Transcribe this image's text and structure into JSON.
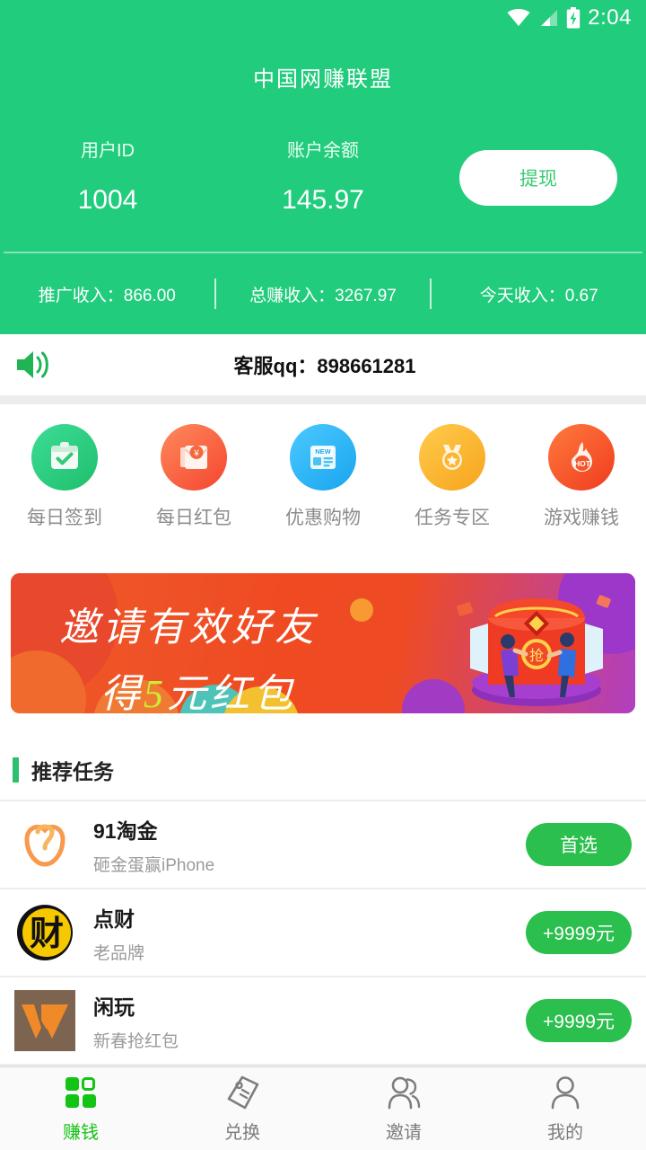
{
  "statusbar": {
    "time": "2:04",
    "icons": [
      "wifi-icon",
      "signal-icon",
      "battery-charging-icon"
    ]
  },
  "header": {
    "app_title": "中国网赚联盟",
    "brand_green": "#22CC7D",
    "account": {
      "user_id_label": "用户ID",
      "user_id_value": "1004",
      "balance_label": "账户余额",
      "balance_value": "145.97",
      "withdraw_label": "提现"
    },
    "stats": [
      {
        "text": "推广收入：866.00"
      },
      {
        "text": "总赚收入：3267.97"
      },
      {
        "text": "今天收入：0.67"
      }
    ]
  },
  "notice": {
    "icon": "speaker-icon",
    "text": "客服qq：898661281"
  },
  "quick_menu": [
    {
      "label": "每日签到",
      "icon": "calendar-check-icon",
      "color": "#1fbf6d"
    },
    {
      "label": "每日红包",
      "icon": "red-envelope-icon",
      "color": "#f4452f"
    },
    {
      "label": "优惠购物",
      "icon": "news-new-icon",
      "color": "#18a5ee"
    },
    {
      "label": "任务专区",
      "icon": "medal-star-icon",
      "color": "#f7a41c"
    },
    {
      "label": "游戏赚钱",
      "icon": "flame-hot-icon",
      "color": "#f03c1e"
    }
  ],
  "banner": {
    "line1": "邀请有效好友",
    "line2_prefix": "得",
    "line2_amount": "5",
    "line2_suffix": "元红包",
    "packet_label": "抢",
    "highlight_color": "#c9ee2e"
  },
  "tasks_section": {
    "title": "推荐任务",
    "accent_color": "#2BBF6E",
    "items": [
      {
        "name": "91淘金",
        "desc": "砸金蛋赢iPhone",
        "button": "首选",
        "icon": "taojin-logo"
      },
      {
        "name": "点财",
        "desc": "老品牌",
        "button": "+9999元",
        "icon": "diancai-logo"
      },
      {
        "name": "闲玩",
        "desc": "新春抢红包",
        "button": "+9999元",
        "icon": "xianwan-logo"
      }
    ]
  },
  "tabbar": {
    "active_color": "#14c414",
    "items": [
      {
        "label": "赚钱",
        "icon": "grid-icon",
        "active": true
      },
      {
        "label": "兑换",
        "icon": "tag-icon",
        "active": false
      },
      {
        "label": "邀请",
        "icon": "people-icon",
        "active": false
      },
      {
        "label": "我的",
        "icon": "person-icon",
        "active": false
      }
    ]
  }
}
